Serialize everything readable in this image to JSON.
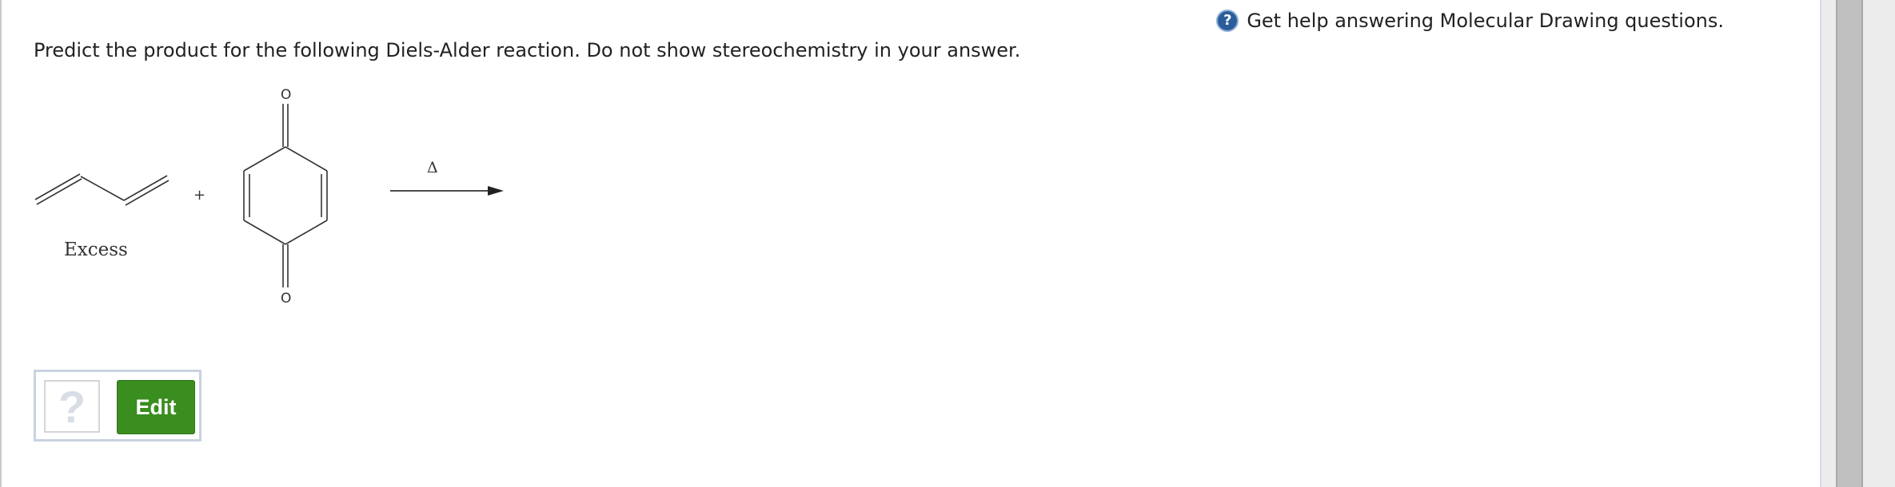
{
  "help": {
    "icon": "question-circle-icon",
    "icon_glyph": "?",
    "label": "Get help answering Molecular Drawing questions."
  },
  "question": {
    "text": "Predict the product for the following Diels-Alder reaction. Do not show stereochemistry in your answer."
  },
  "reaction": {
    "plus": "+",
    "excess_label": "Excess",
    "oxygen_top": "O",
    "oxygen_bottom": "O",
    "heat_symbol": "Δ"
  },
  "answer": {
    "placeholder_glyph": "?",
    "edit_label": "Edit",
    "edit_color": "#3a8d1f"
  },
  "colors": {
    "help_icon": "#2b5d9b",
    "border": "#c9d3e0",
    "text": "#222222"
  }
}
